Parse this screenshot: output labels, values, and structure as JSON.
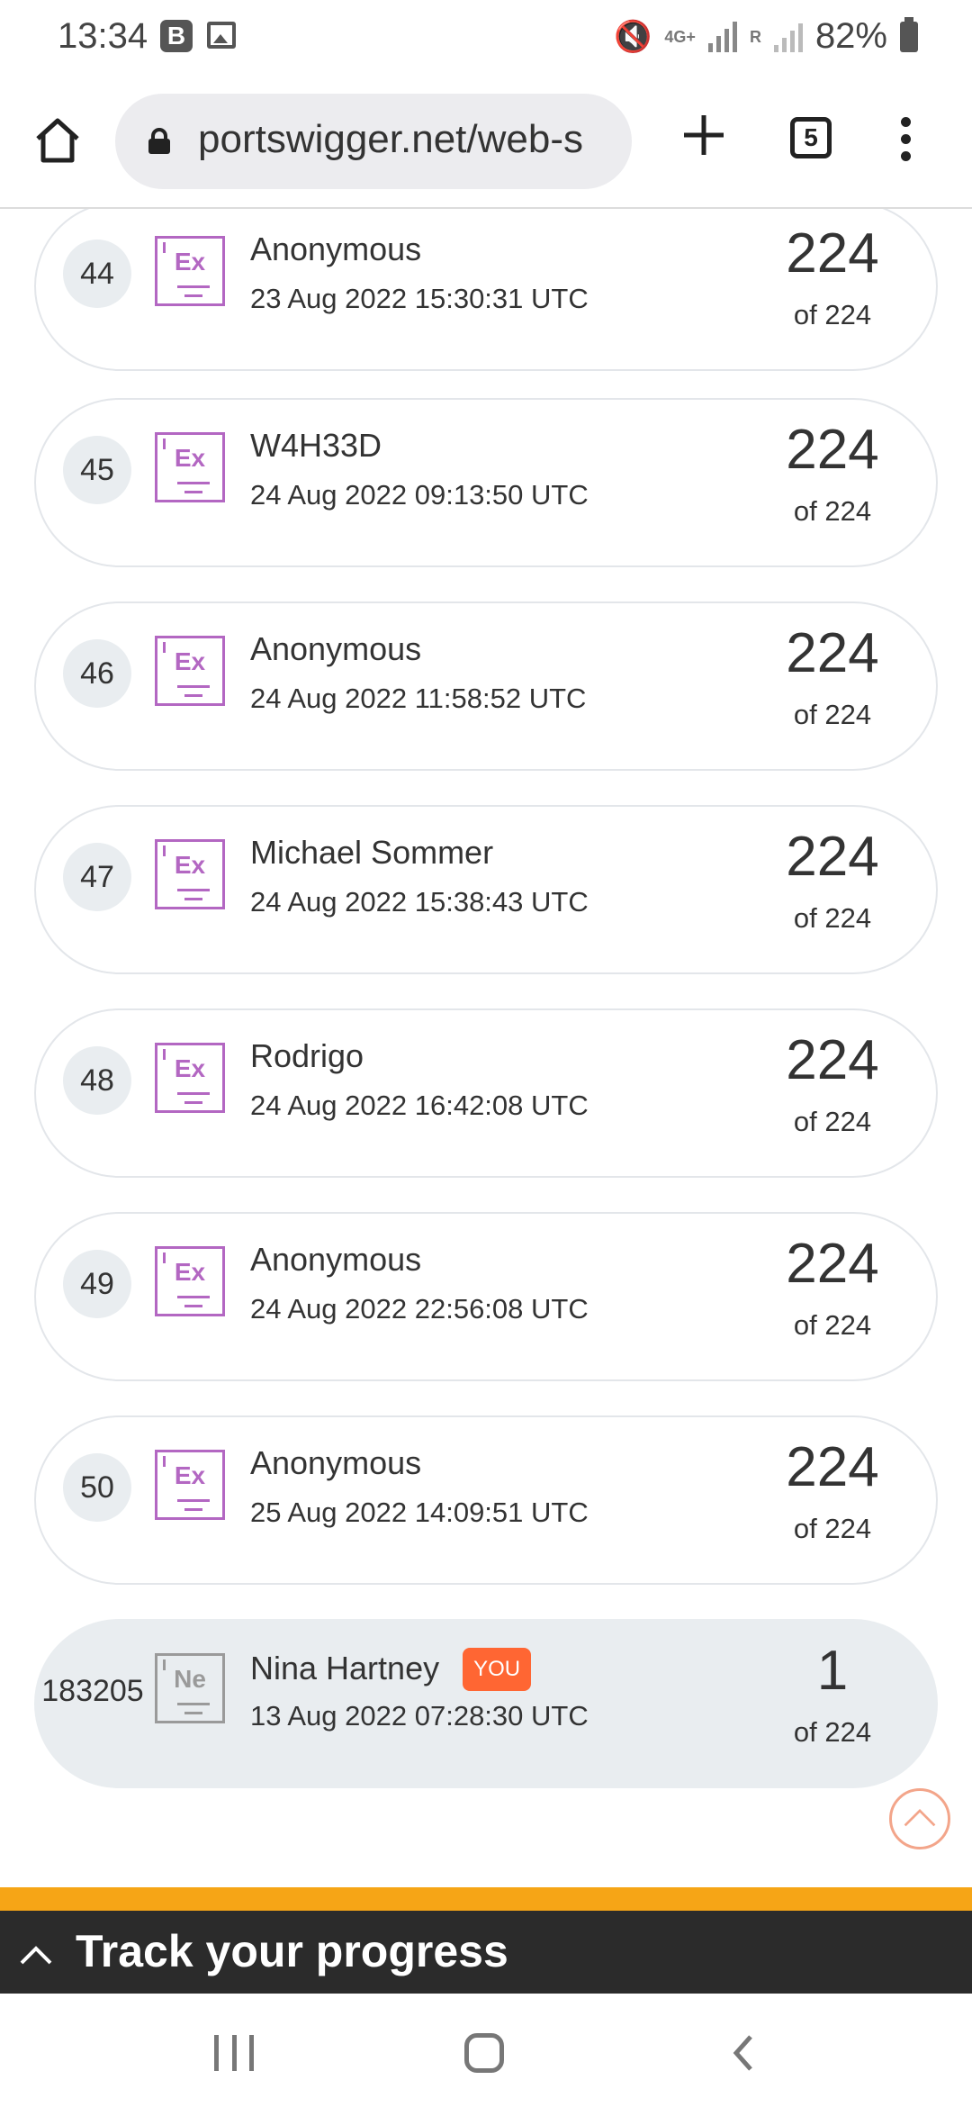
{
  "status_bar": {
    "time": "13:34",
    "notif_b": "B",
    "network": "4G+",
    "roaming": "R",
    "battery": "82%"
  },
  "browser": {
    "url": "portswigger.net/web-s",
    "tab_count": "5"
  },
  "leaderboard": {
    "rows": [
      {
        "rank": "44",
        "badge": "Ex",
        "name": "Anonymous",
        "date": "23 Aug 2022 15:30:31 UTC",
        "score": "224",
        "total": "of 224"
      },
      {
        "rank": "45",
        "badge": "Ex",
        "name": "W4H33D",
        "date": "24 Aug 2022 09:13:50 UTC",
        "score": "224",
        "total": "of 224"
      },
      {
        "rank": "46",
        "badge": "Ex",
        "name": "Anonymous",
        "date": "24 Aug 2022 11:58:52 UTC",
        "score": "224",
        "total": "of 224"
      },
      {
        "rank": "47",
        "badge": "Ex",
        "name": "Michael Sommer",
        "date": "24 Aug 2022 15:38:43 UTC",
        "score": "224",
        "total": "of 224"
      },
      {
        "rank": "48",
        "badge": "Ex",
        "name": "Rodrigo",
        "date": "24 Aug 2022 16:42:08 UTC",
        "score": "224",
        "total": "of 224"
      },
      {
        "rank": "49",
        "badge": "Ex",
        "name": "Anonymous",
        "date": "24 Aug 2022 22:56:08 UTC",
        "score": "224",
        "total": "of 224"
      },
      {
        "rank": "50",
        "badge": "Ex",
        "name": "Anonymous",
        "date": "25 Aug 2022 14:09:51 UTC",
        "score": "224",
        "total": "of 224"
      }
    ],
    "current_user": {
      "rank": "183205",
      "badge": "Ne",
      "name": "Nina Hartney",
      "you_label": "YOU",
      "date": "13 Aug 2022 07:28:30 UTC",
      "score": "1",
      "total": "of 224"
    }
  },
  "track_progress": {
    "label": "Track your progress"
  },
  "colors": {
    "expert_badge": "#b367c2",
    "newbie_badge": "#9a9a9a",
    "you_tag": "#ff6633",
    "track_accent": "#f6a516",
    "track_bg": "#2b2b2b"
  },
  "icons": [
    "home-icon",
    "lock-icon",
    "plus-icon",
    "tabs-icon",
    "more-vert-icon",
    "scroll-top-icon",
    "chevron-up-icon",
    "nav-recent-icon",
    "nav-home-icon",
    "nav-back-icon"
  ]
}
